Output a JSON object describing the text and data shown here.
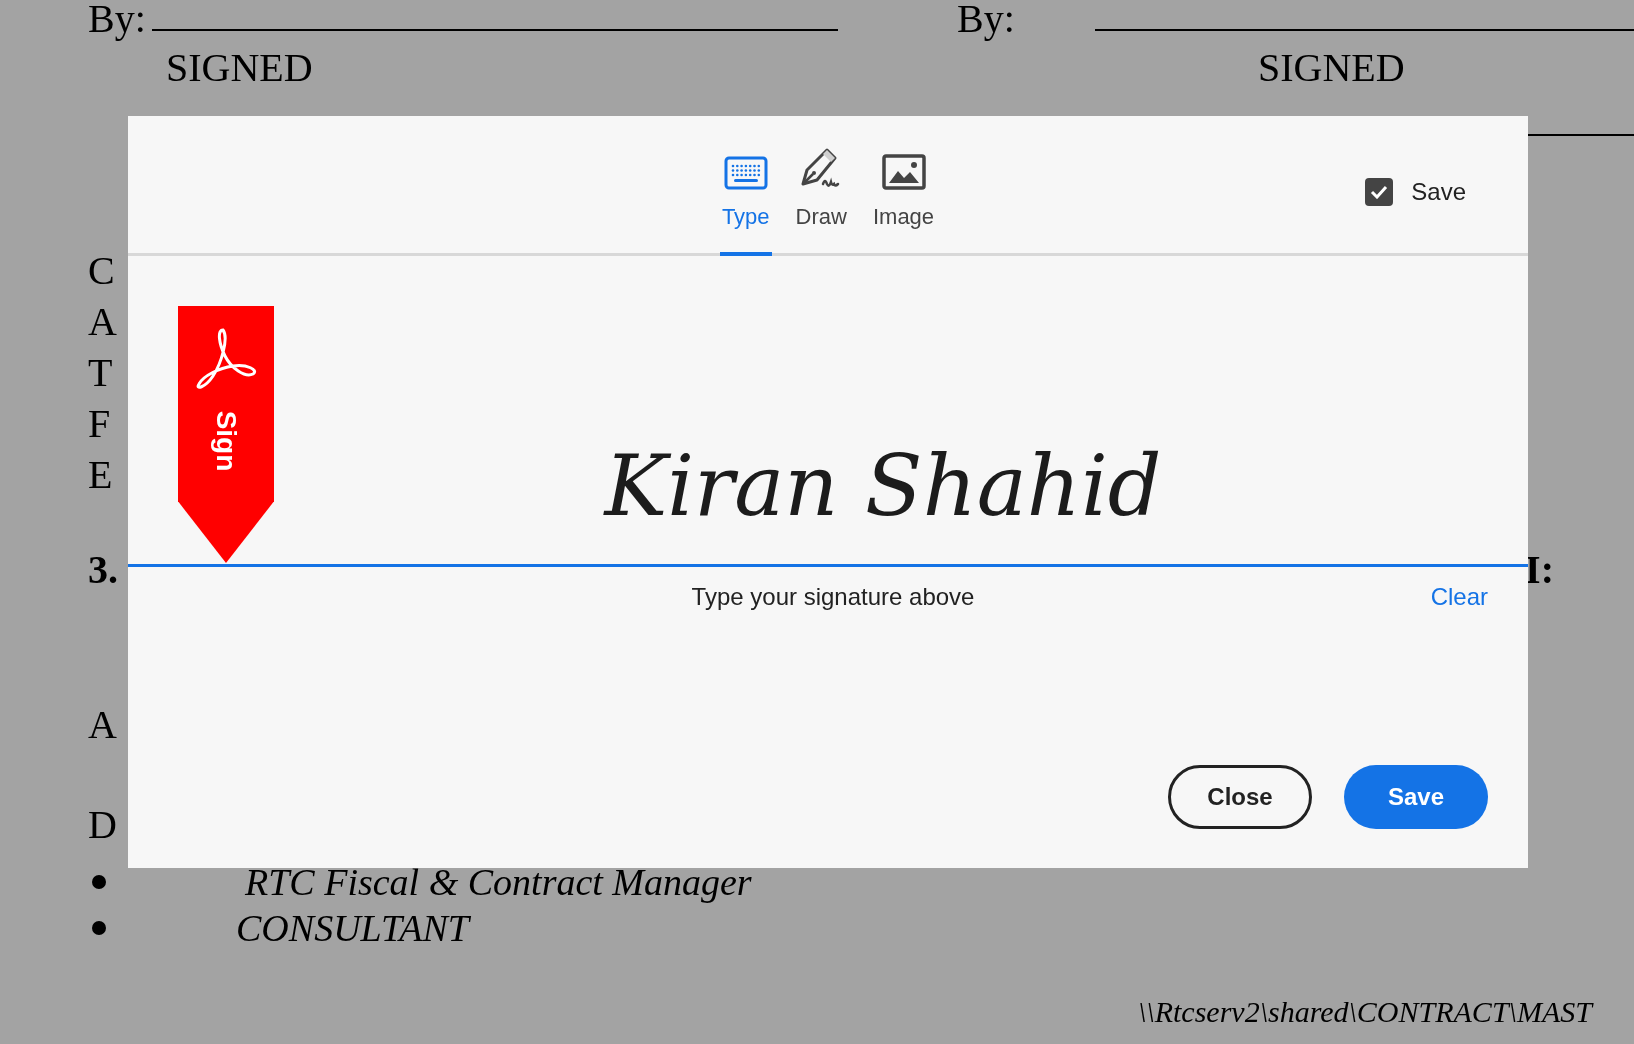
{
  "document": {
    "signature_blocks": [
      {
        "label": "By:",
        "signed": "SIGNED"
      },
      {
        "label": "By:",
        "signed": "SIGNED"
      }
    ],
    "left_fragments": [
      "C",
      "A",
      "T",
      "F",
      "E"
    ],
    "section_number": "3.",
    "right_fragment": "I:",
    "lower_fragments": [
      "A",
      "D"
    ],
    "bullets": [
      "RTC Fiscal & Contract Manager",
      "CONSULTANT"
    ],
    "footer_path": "\\\\Rtcserv2\\shared\\CONTRACT\\MAST"
  },
  "dialog": {
    "tabs": [
      {
        "label": "Type",
        "kind": "keyboard",
        "selected": true
      },
      {
        "label": "Draw",
        "kind": "pen",
        "selected": false
      },
      {
        "label": "Image",
        "kind": "image",
        "selected": false
      }
    ],
    "save_option": {
      "label": "Save",
      "checked": true
    },
    "badge": {
      "label": "Sign"
    },
    "signature": "Kiran Shahid",
    "hint": "Type your signature above",
    "clear": "Clear",
    "buttons": [
      {
        "label": "Close",
        "kind": "secondary"
      },
      {
        "label": "Save",
        "kind": "primary"
      }
    ]
  }
}
